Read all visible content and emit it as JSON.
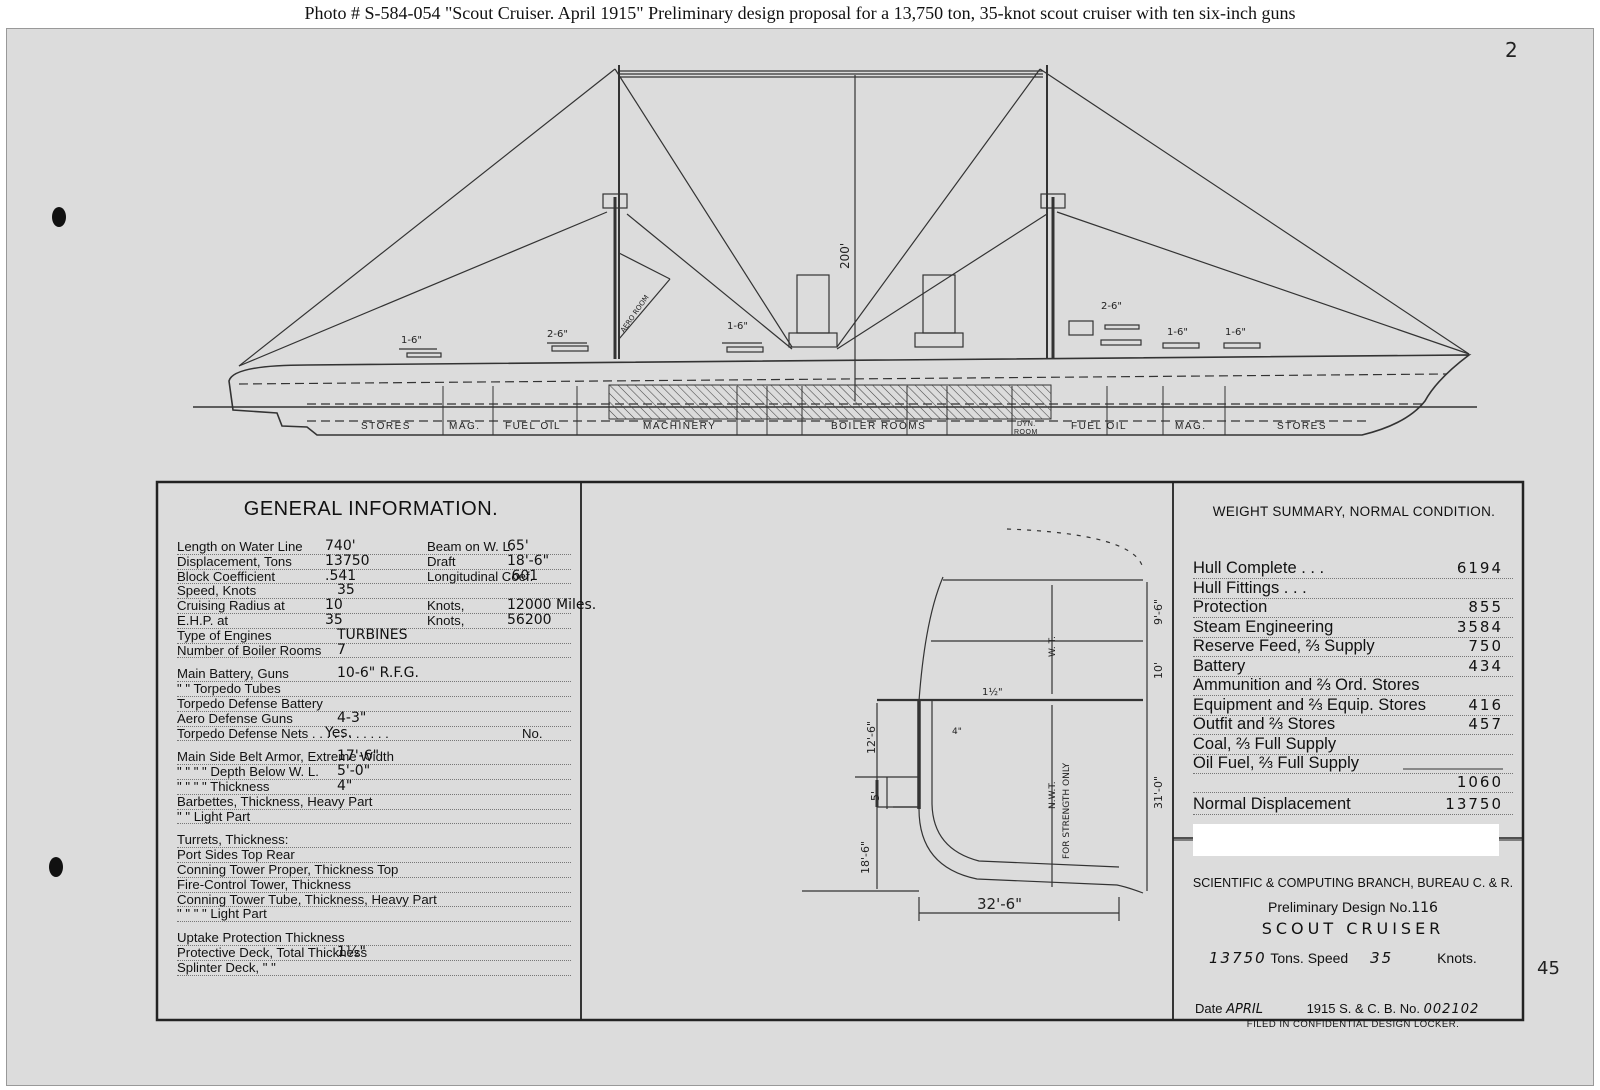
{
  "caption": "Photo #   S-584-054   \"Scout Cruiser.  April 1915\"     Preliminary design proposal for a 13,750 ton, 35-knot scout cruiser with ten six-inch guns",
  "profile": {
    "gun_labels": [
      "1-6\"",
      "2-6\"",
      "1-6\"",
      "2-6\"",
      "1-6\"",
      "1-6\""
    ],
    "mast_height": "200'",
    "aero_room": "AERO ROOM",
    "compartments": [
      "STORES",
      "MAG.",
      "FUEL OIL",
      "MACHINERY",
      "BOILER ROOMS",
      "DYN.",
      "ROOM",
      "FUEL OIL",
      "MAG.",
      "STORES"
    ]
  },
  "general_info": {
    "title": "GENERAL INFORMATION.",
    "rows": [
      {
        "a": "Length on Water Line",
        "v1": "740'",
        "b": "Beam on W. L.",
        "v2": "65'"
      },
      {
        "a": "Displacement, Tons",
        "v1": "13750",
        "b": "Draft",
        "v2": "18'-6\""
      },
      {
        "a": "Block Coefficient",
        "v1": ".541",
        "b": "Longitudinal Coef.",
        "v2": ".601"
      },
      {
        "a": "Speed, Knots",
        "v1": "35",
        "b": "",
        "v2": ""
      },
      {
        "a": "Cruising Radius at",
        "v1": "10",
        "b": "Knots,",
        "v2": "12000 Miles."
      },
      {
        "a": "E.H.P. at",
        "v1": "35",
        "b": "Knots,",
        "v2": "56200"
      },
      {
        "a": "Type of Engines",
        "v1": "TURBINES",
        "b": "",
        "v2": ""
      },
      {
        "a": "Number of Boiler Rooms",
        "v1": "7",
        "b": "",
        "v2": ""
      },
      {
        "a": "Main Battery, Guns",
        "v1": "10-6\" R.F.G.",
        "b": "",
        "v2": "",
        "gap": true
      },
      {
        "a": "\"          \"     Torpedo Tubes",
        "v1": "",
        "b": "",
        "v2": ""
      },
      {
        "a": "Torpedo Defense Battery",
        "v1": "",
        "b": "",
        "v2": ""
      },
      {
        "a": "Aero Defense Guns",
        "v1": "4-3\"",
        "b": "",
        "v2": ""
      },
      {
        "a": "Torpedo Defense Nets . . . . . . . . . . .",
        "v1": "Yes.",
        "b": "No.",
        "v2": ""
      },
      {
        "a": "Main Side Belt Armor, Extreme Width",
        "v1": "17'-6\"",
        "b": "",
        "v2": "",
        "gap": true
      },
      {
        "a": "\"       \"      \"      \"     Depth Below W. L.",
        "v1": "5'-0\"",
        "b": "",
        "v2": ""
      },
      {
        "a": "\"       \"      \"      \"     Thickness",
        "v1": "4\"",
        "b": "",
        "v2": ""
      },
      {
        "a": "Barbettes, Thickness, Heavy Part",
        "v1": "",
        "b": "",
        "v2": ""
      },
      {
        "a": "\"             \"        Light Part",
        "v1": "",
        "b": "",
        "v2": ""
      },
      {
        "a": "Turrets, Thickness:",
        "v1": "",
        "b": "",
        "v2": "",
        "gap": true
      },
      {
        "a": "Port            Sides            Top            Rear",
        "v1": "",
        "b": "",
        "v2": ""
      },
      {
        "a": "Conning Tower Proper, Thickness                   Top",
        "v1": "",
        "b": "",
        "v2": ""
      },
      {
        "a": "Fire-Control Tower, Thickness",
        "v1": "",
        "b": "",
        "v2": ""
      },
      {
        "a": "Conning Tower Tube, Thickness, Heavy Part",
        "v1": "",
        "b": "",
        "v2": ""
      },
      {
        "a": "\"        \"        \"        \"           Light Part",
        "v1": "",
        "b": "",
        "v2": ""
      },
      {
        "a": "Uptake Protection Thickness",
        "v1": "",
        "b": "",
        "v2": "",
        "gap": true
      },
      {
        "a": "Protective Deck, Total Thickness",
        "v1": "1½\"",
        "b": "",
        "v2": ""
      },
      {
        "a": "Splinter Deck,           \"            \"",
        "v1": "",
        "b": "",
        "v2": ""
      }
    ]
  },
  "section": {
    "wt": "W. T.",
    "nwt": "N.W.T.",
    "strength": "FOR STRENGTH ONLY",
    "deck": "1½\"",
    "belt": "4\"",
    "dims": [
      "9'-6\"",
      "10'",
      "31'-0\"",
      "12'-6\"",
      "5'",
      "18'-6\"",
      "32'-6\""
    ]
  },
  "weight_summary": {
    "title": "WEIGHT SUMMARY, NORMAL CONDITION.",
    "rows": [
      {
        "label": "Hull Complete   .   .   .",
        "value": "6194"
      },
      {
        "label": "Hull Fittings   .   .   .",
        "value": ""
      },
      {
        "label": "Protection",
        "value": "855"
      },
      {
        "label": "Steam Engineering",
        "value": "3584"
      },
      {
        "label": "Reserve Feed, ⅔ Supply",
        "value": "750"
      },
      {
        "label": "Battery",
        "value": "434"
      },
      {
        "label": "Ammunition and ⅔ Ord. Stores",
        "value": ""
      },
      {
        "label": "Equipment and ⅔ Equip. Stores",
        "value": "416"
      },
      {
        "label": "Outfit and ⅔ Stores",
        "value": "457"
      },
      {
        "label": "Coal, ⅔ Full Supply",
        "value": ""
      },
      {
        "label": "Oil Fuel, ⅔ Full Supply",
        "value": ""
      }
    ],
    "margin_value": "1060",
    "normal_label": "Normal Displacement",
    "normal_value": "13750"
  },
  "title_block": {
    "branch": "SCIENTIFIC & COMPUTING BRANCH, BUREAU C. & R.",
    "design_prefix": "Preliminary Design No.",
    "design_no": "116",
    "name": "SCOUT CRUISER",
    "tons_value": "13750",
    "tons_label": "Tons.   Speed",
    "speed_value": "35",
    "knots": "Knots.",
    "date_label": "Date",
    "date_value": "APRIL",
    "year_no": "1915 S. & C. B. No.",
    "sc_no": "002102",
    "filed": "FILED IN CONFIDENTIAL DESIGN LOCKER."
  },
  "margin_marks": {
    "top_right": "2",
    "side": "45"
  }
}
